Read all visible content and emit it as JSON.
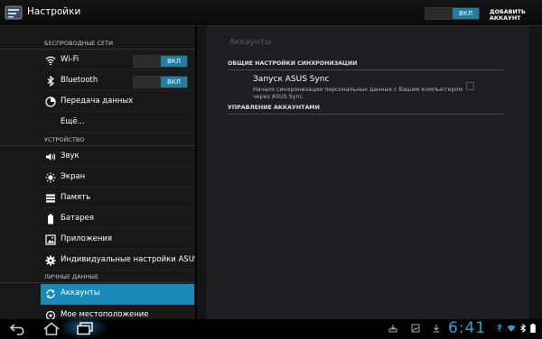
{
  "actionbar": {
    "title": "Настройки",
    "master_toggle": "ВКЛ",
    "add_account": "ДОБАВИТЬ АККАУНТ"
  },
  "sidebar": {
    "sections": [
      {
        "title": "БЕСПРОВОДНЫЕ СЕТИ"
      },
      {
        "title": "УСТРОЙСТВО"
      },
      {
        "title": "ЛИЧНЫЕ ДАННЫЕ"
      }
    ],
    "items": [
      {
        "label": "Wi-Fi",
        "icon": "wifi-icon",
        "toggle": "ВКЛ"
      },
      {
        "label": "Bluetooth",
        "icon": "bluetooth-icon",
        "toggle": "ВКЛ"
      },
      {
        "label": "Передача данных",
        "icon": "data-usage-icon"
      },
      {
        "label": "Ещё..."
      },
      {
        "label": "Звук",
        "icon": "sound-icon"
      },
      {
        "label": "Экран",
        "icon": "display-icon"
      },
      {
        "label": "Память",
        "icon": "storage-icon"
      },
      {
        "label": "Батарея",
        "icon": "battery-icon"
      },
      {
        "label": "Приложения",
        "icon": "apps-icon"
      },
      {
        "label": "Индивидуальные настройки ASUS",
        "icon": "asus-settings-icon"
      },
      {
        "label": "Аккаунты",
        "icon": "sync-icon",
        "selected": true
      },
      {
        "label": "Мое местоположение",
        "icon": "location-icon"
      }
    ]
  },
  "main": {
    "title": "Аккаунты",
    "general_header": "ОБЩИЕ НАСТРОЙКИ СИНХРОНИЗАЦИИ",
    "sync_title": "Запуск ASUS Sync",
    "sync_desc": "Начало синхронизации персональных данных с Вашим компьютером через ASUS Sync.",
    "manage_header": "УПРАВЛЕНИЕ АККАУНТАМИ"
  },
  "status": {
    "time": "6:41"
  },
  "colors": {
    "accent": "#1a8ab8",
    "clock": "#2aa3d6"
  }
}
